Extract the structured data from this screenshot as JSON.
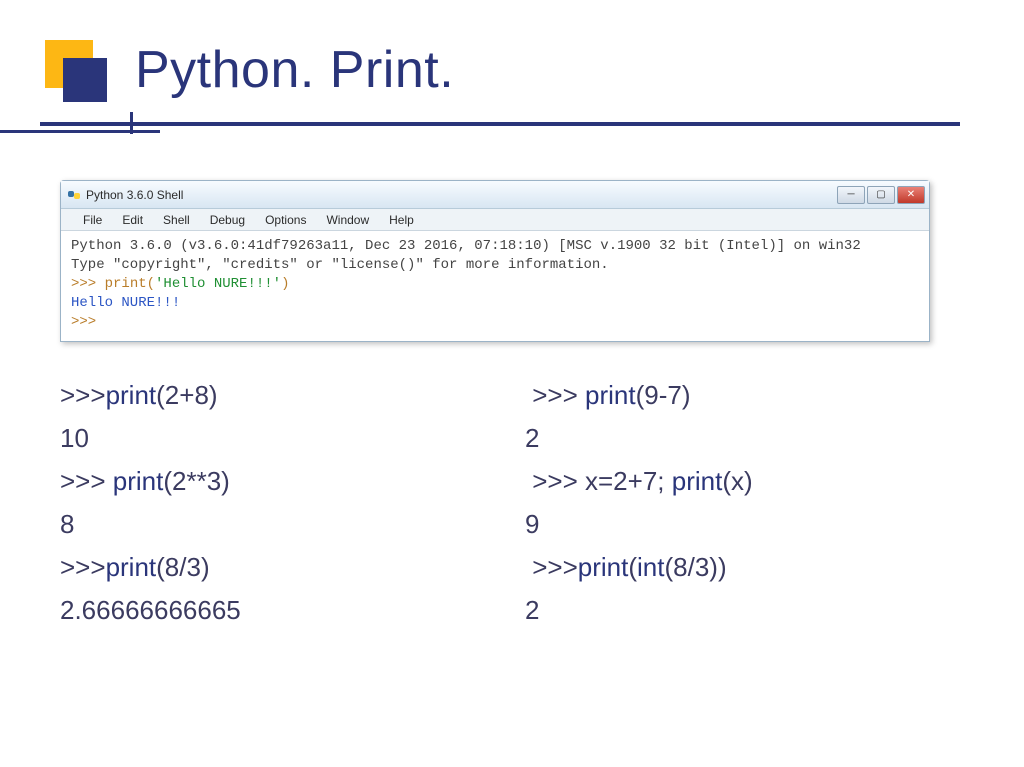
{
  "title": "Python. Print.",
  "window": {
    "title": "Python 3.6.0 Shell",
    "menus": [
      "File",
      "Edit",
      "Shell",
      "Debug",
      "Options",
      "Window",
      "Help"
    ],
    "line1": "Python 3.6.0 (v3.6.0:41df79263a11, Dec 23 2016, 07:18:10) [MSC v.1900 32 bit (Intel)] on win32",
    "line2": "Type \"copyright\", \"credits\" or \"license()\" for more information.",
    "input_prefix": ">>> ",
    "input_code_pre": "print(",
    "input_code_str": "'Hello NURE!!!'",
    "input_code_post": ")",
    "output": "Hello NURE!!!",
    "prompt": ">>>"
  },
  "left": {
    "l1_pre": ">>>",
    "l1_fn": "print",
    "l1_post": "(2+8)",
    "l2": "10",
    "l3_pre": ">>> ",
    "l3_fn": "print",
    "l3_post": "(2**3)",
    "l4": "8",
    "l5_pre": ">>>",
    "l5_fn": "print",
    "l5_post": "(8/3)",
    "l6": "2.66666666665"
  },
  "right": {
    "l1_pre": " >>> ",
    "l1_fn": "print",
    "l1_post": "(9-7)",
    "l2": "2",
    "l3_pre": " >>> x=2+7; ",
    "l3_fn": "print",
    "l3_post": "(x)",
    "l4": "9",
    "l5_pre": " >>>",
    "l5_fna": "print",
    "l5_mid": "(",
    "l5_fnb": "int",
    "l5_post": "(8/3))",
    "l6": "2"
  }
}
